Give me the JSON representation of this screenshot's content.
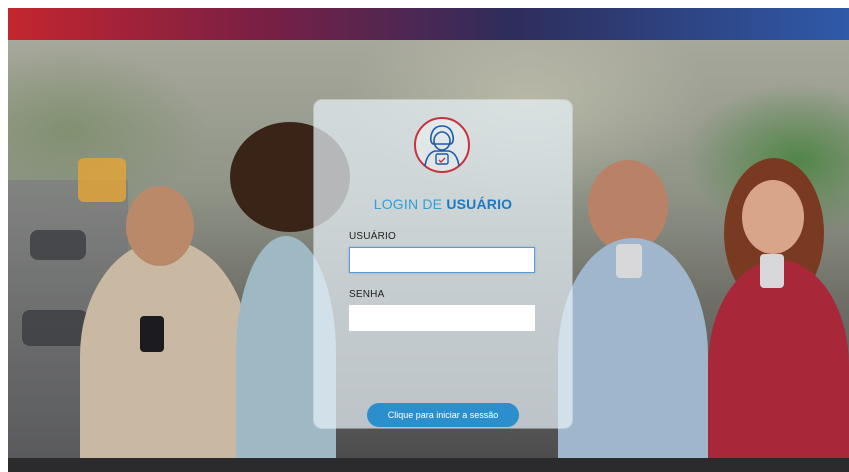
{
  "login": {
    "title_prefix": "LOGIN DE ",
    "title_emphasis": "USUÁRIO",
    "username_label": "USUÁRIO",
    "username_value": "",
    "password_label": "SENHA",
    "password_value": "",
    "submit_label": "Clique para iniciar a sessão",
    "avatar_icon": "user-avatar-icon"
  },
  "colors": {
    "accent": "#2a8fcc",
    "title_light": "#2f9fd6",
    "title_bold": "#1e78c2",
    "avatar_ring": "#c8323c",
    "avatar_figure": "#1e5aa8",
    "top_bar_start": "#c4262e",
    "top_bar_end": "#2f5aa8"
  }
}
